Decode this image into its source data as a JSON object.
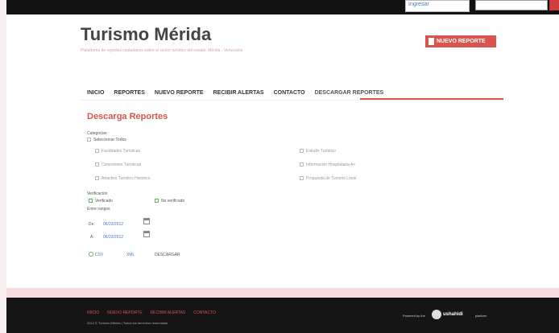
{
  "topbar": {
    "search_text": "Ingresar"
  },
  "header": {
    "title": "Turismo Mérida",
    "subtitle": "Plataforma de reportes ciudadanos sobre el sector turístico del estado, Mérida - Venezuela",
    "new_report_label": "NUEVO REPORTE"
  },
  "nav": {
    "items": [
      {
        "label": "INICIO"
      },
      {
        "label": "REPORTES"
      },
      {
        "label": "NUEVO REPORTE"
      },
      {
        "label": "RECIBIR ALERTAS"
      },
      {
        "label": "CONTACTO"
      },
      {
        "label": "DESCARGAR REPORTES"
      }
    ],
    "active_index": 5
  },
  "download": {
    "title": "Descarga Reportes",
    "categories_label": "Categorías",
    "select_all_label": "Seleccionar Todos",
    "categories": [
      "Facilidades Turísticas",
      "Conexiones Turísticas",
      "Atractivo Turístico Histórico",
      "Estudio Turístico",
      "Información Hospitalaria A+",
      "Propuesta de Turismo Local"
    ],
    "verification_label": "Verificación",
    "verified_label": "Verificado",
    "unverified_label": "No verificado",
    "date_range_label": "Entre rangos",
    "from_label": "De:",
    "from_date": "06/23/2012",
    "to_label": "A:",
    "to_date": "06/23/2012",
    "csv_label": "CSV",
    "xml_label": "XML",
    "download_label": "DESCARGAR"
  },
  "footer": {
    "links": [
      "INICIO",
      "NUEVO REPORTE",
      "RECIBIR ALERTAS",
      "CONTACTO"
    ],
    "copyright": "2012 © Turismo Mérida | Todos los derechos reservados",
    "powered_by": "Powered by the",
    "logo_text": "ushahidi",
    "tail_text": "platform"
  }
}
